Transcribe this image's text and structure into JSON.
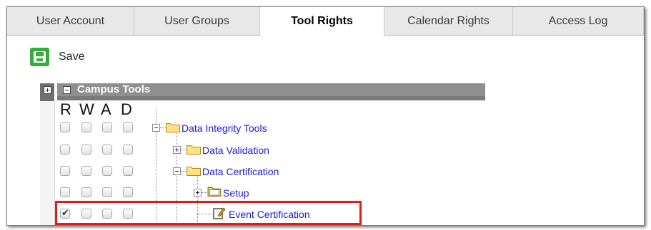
{
  "tabs": [
    {
      "label": "User Account",
      "active": false
    },
    {
      "label": "User Groups",
      "active": false
    },
    {
      "label": "Tool Rights",
      "active": true
    },
    {
      "label": "Calendar Rights",
      "active": false
    },
    {
      "label": "Access Log",
      "active": false
    }
  ],
  "toolbar": {
    "save_label": "Save",
    "save_icon": "floppy-disk-icon",
    "accent": "#3aa93f"
  },
  "tree": {
    "header_title": "Campus Tools",
    "permission_columns": [
      "R",
      "W",
      "A",
      "D"
    ],
    "nodes": [
      {
        "label": "Data Integrity Tools",
        "expanded": true,
        "icon": "folder-icon",
        "rights": [
          false,
          false,
          false,
          false
        ]
      },
      {
        "label": "Data Validation",
        "expanded": false,
        "icon": "folder-icon",
        "rights": [
          false,
          false,
          false,
          false
        ]
      },
      {
        "label": "Data Certification",
        "expanded": true,
        "icon": "folder-icon",
        "rights": [
          false,
          false,
          false,
          false
        ]
      },
      {
        "label": "Setup",
        "expanded": false,
        "icon": "open-folder-icon",
        "rights": [
          false,
          false,
          false,
          false
        ]
      },
      {
        "label": "Event Certification",
        "icon": "edit-document-icon",
        "rights": [
          true,
          false,
          false,
          false
        ],
        "highlighted": true
      }
    ]
  },
  "colors": {
    "highlight": "#e01b1b",
    "link": "#1a1ad0",
    "header_bg": "#8f8f8f"
  }
}
